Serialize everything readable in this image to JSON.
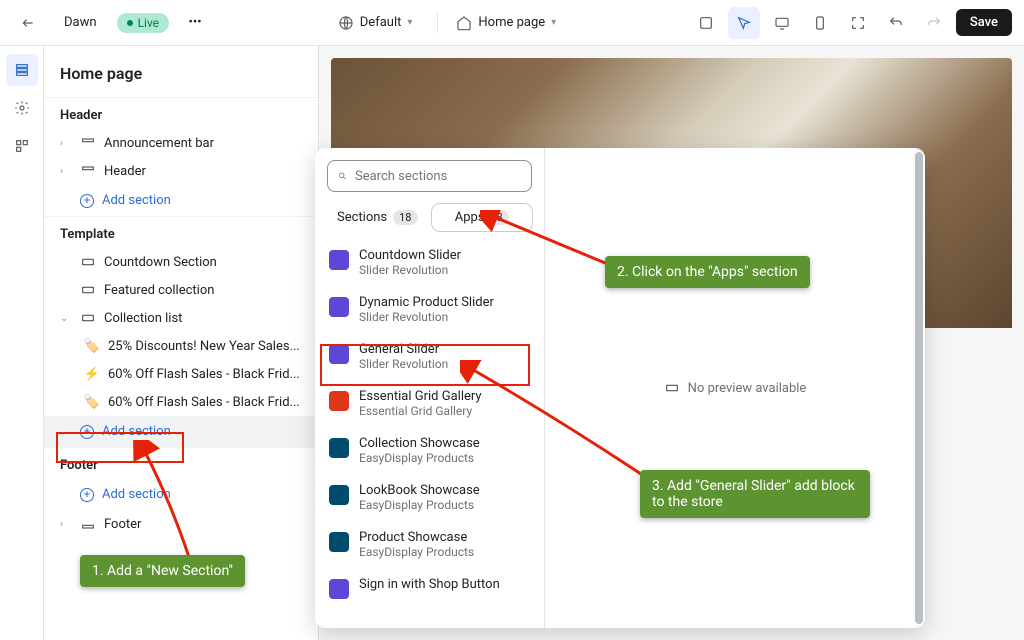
{
  "topbar": {
    "theme_name": "Dawn",
    "live_label": "Live",
    "default_label": "Default",
    "home_label": "Home page",
    "save_label": "Save"
  },
  "sidebar": {
    "title": "Home page",
    "groups": {
      "header": {
        "title": "Header",
        "items": [
          "Announcement bar",
          "Header"
        ],
        "add": "Add section"
      },
      "template": {
        "title": "Template",
        "items": {
          "countdown": "Countdown Section",
          "featured": "Featured collection",
          "collection_list": "Collection list",
          "discount1": "25% Discounts! New Year Sales...",
          "discount2": "60% Off Flash Sales - Black Frid...",
          "discount3": "60% Off Flash Sales - Black Frid..."
        },
        "add": "Add section"
      },
      "footer": {
        "title": "Footer",
        "add": "Add section",
        "item": "Footer"
      }
    }
  },
  "popup": {
    "search_placeholder": "Search sections",
    "tabs": {
      "sections": "Sections",
      "sections_count": "18",
      "apps": "Apps",
      "apps_count": "8"
    },
    "no_preview": "No preview available",
    "apps": [
      {
        "name": "Countdown Slider",
        "sub": "Slider Revolution",
        "color": "purple"
      },
      {
        "name": "Dynamic Product Slider",
        "sub": "Slider Revolution",
        "color": "purple"
      },
      {
        "name": "General Slider",
        "sub": "Slider Revolution",
        "color": "purple"
      },
      {
        "name": "Essential Grid Gallery",
        "sub": "Essential Grid Gallery",
        "color": "red"
      },
      {
        "name": "Collection Showcase",
        "sub": "EasyDisplay Products",
        "color": "teal"
      },
      {
        "name": "LookBook Showcase",
        "sub": "EasyDisplay Products",
        "color": "teal"
      },
      {
        "name": "Product Showcase",
        "sub": "EasyDisplay Products",
        "color": "teal"
      },
      {
        "name": "Sign in with Shop Button",
        "sub": "",
        "color": "purple"
      }
    ]
  },
  "callouts": {
    "c1": "1. Add a \"New Section\"",
    "c2": "2. Click on the \"Apps\" section",
    "c3": "3. Add \"General Slider\" add block to the store"
  }
}
